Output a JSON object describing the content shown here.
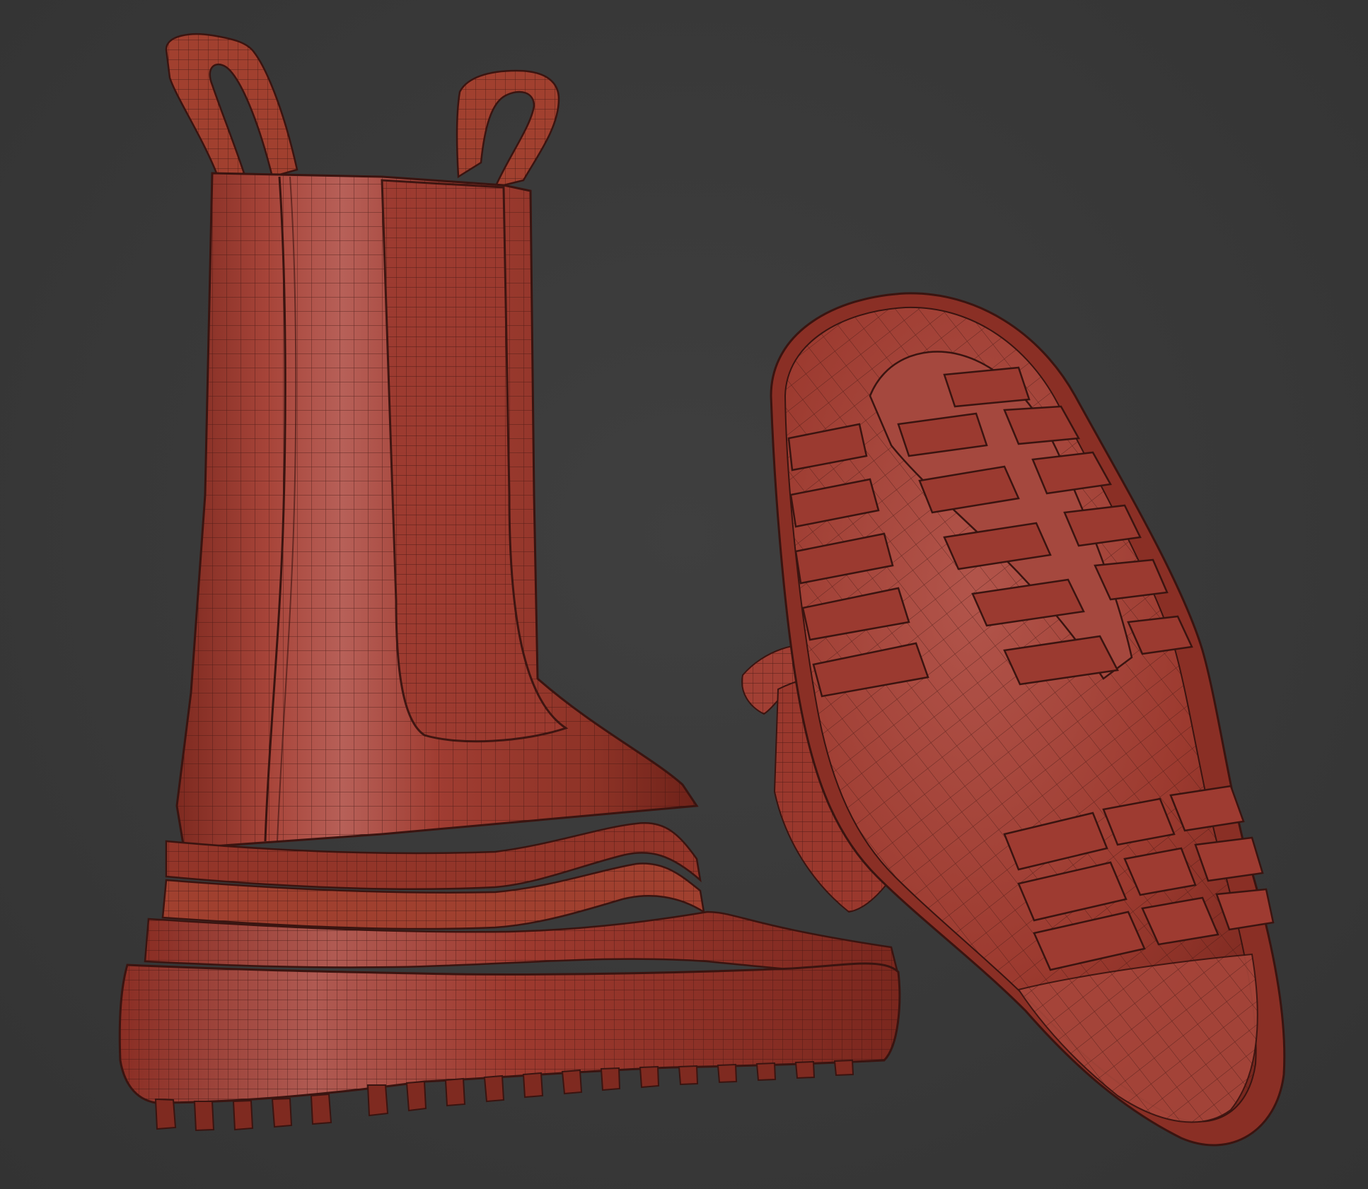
{
  "scene": {
    "background_color": "#3a3a3a",
    "model_color": "#a23c30",
    "wire_color": "#3a1410",
    "objects": [
      {
        "name": "boot-side-view",
        "kind": "chelsea-boot",
        "view": "side"
      },
      {
        "name": "boot-sole-view",
        "kind": "chelsea-boot",
        "view": "sole"
      }
    ]
  }
}
